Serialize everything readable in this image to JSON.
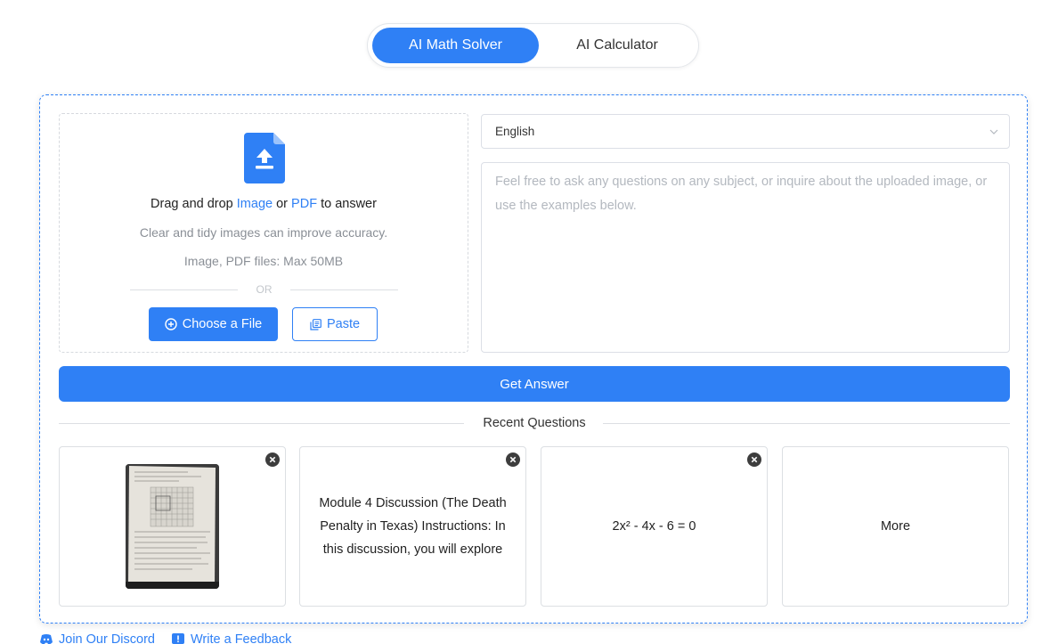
{
  "tabs": [
    {
      "label": "AI Math Solver",
      "active": true
    },
    {
      "label": "AI Calculator",
      "active": false
    }
  ],
  "upload": {
    "title_prefix": "Drag and drop ",
    "title_image": "Image",
    "title_or": " or ",
    "title_pdf": "PDF",
    "title_suffix": " to answer",
    "hint1": "Clear and tidy images can improve accuracy.",
    "hint2": "Image, PDF files: Max 50MB",
    "or": "OR",
    "choose_label": "Choose a File",
    "paste_label": "Paste"
  },
  "language": {
    "selected": "English"
  },
  "question": {
    "value": "",
    "placeholder": "Feel free to ask any questions on any subject, or inquire about the uploaded image, or use the examples below."
  },
  "get_answer_label": "Get Answer",
  "recent": {
    "title": "Recent Questions",
    "cards": [
      {
        "type": "image",
        "text": ""
      },
      {
        "type": "text",
        "text": "Module 4 Discussion (The Death Penalty in Texas) Instructions: In this discussion, you will explore"
      },
      {
        "type": "text",
        "text": "2x² - 4x - 6 = 0"
      },
      {
        "type": "more",
        "text": "More"
      }
    ]
  },
  "footer": {
    "discord_label": "Join Our Discord",
    "feedback_label": "Write a Feedback"
  },
  "colors": {
    "accent": "#2f80f5",
    "border": "#dcdfe3"
  },
  "icons": {
    "upload": "file-upload-icon",
    "choose": "plus-circle-icon",
    "paste": "copy-icon",
    "close": "close-circle-icon",
    "select": "chevron-down-icon",
    "discord": "discord-icon",
    "feedback": "feedback-icon"
  }
}
